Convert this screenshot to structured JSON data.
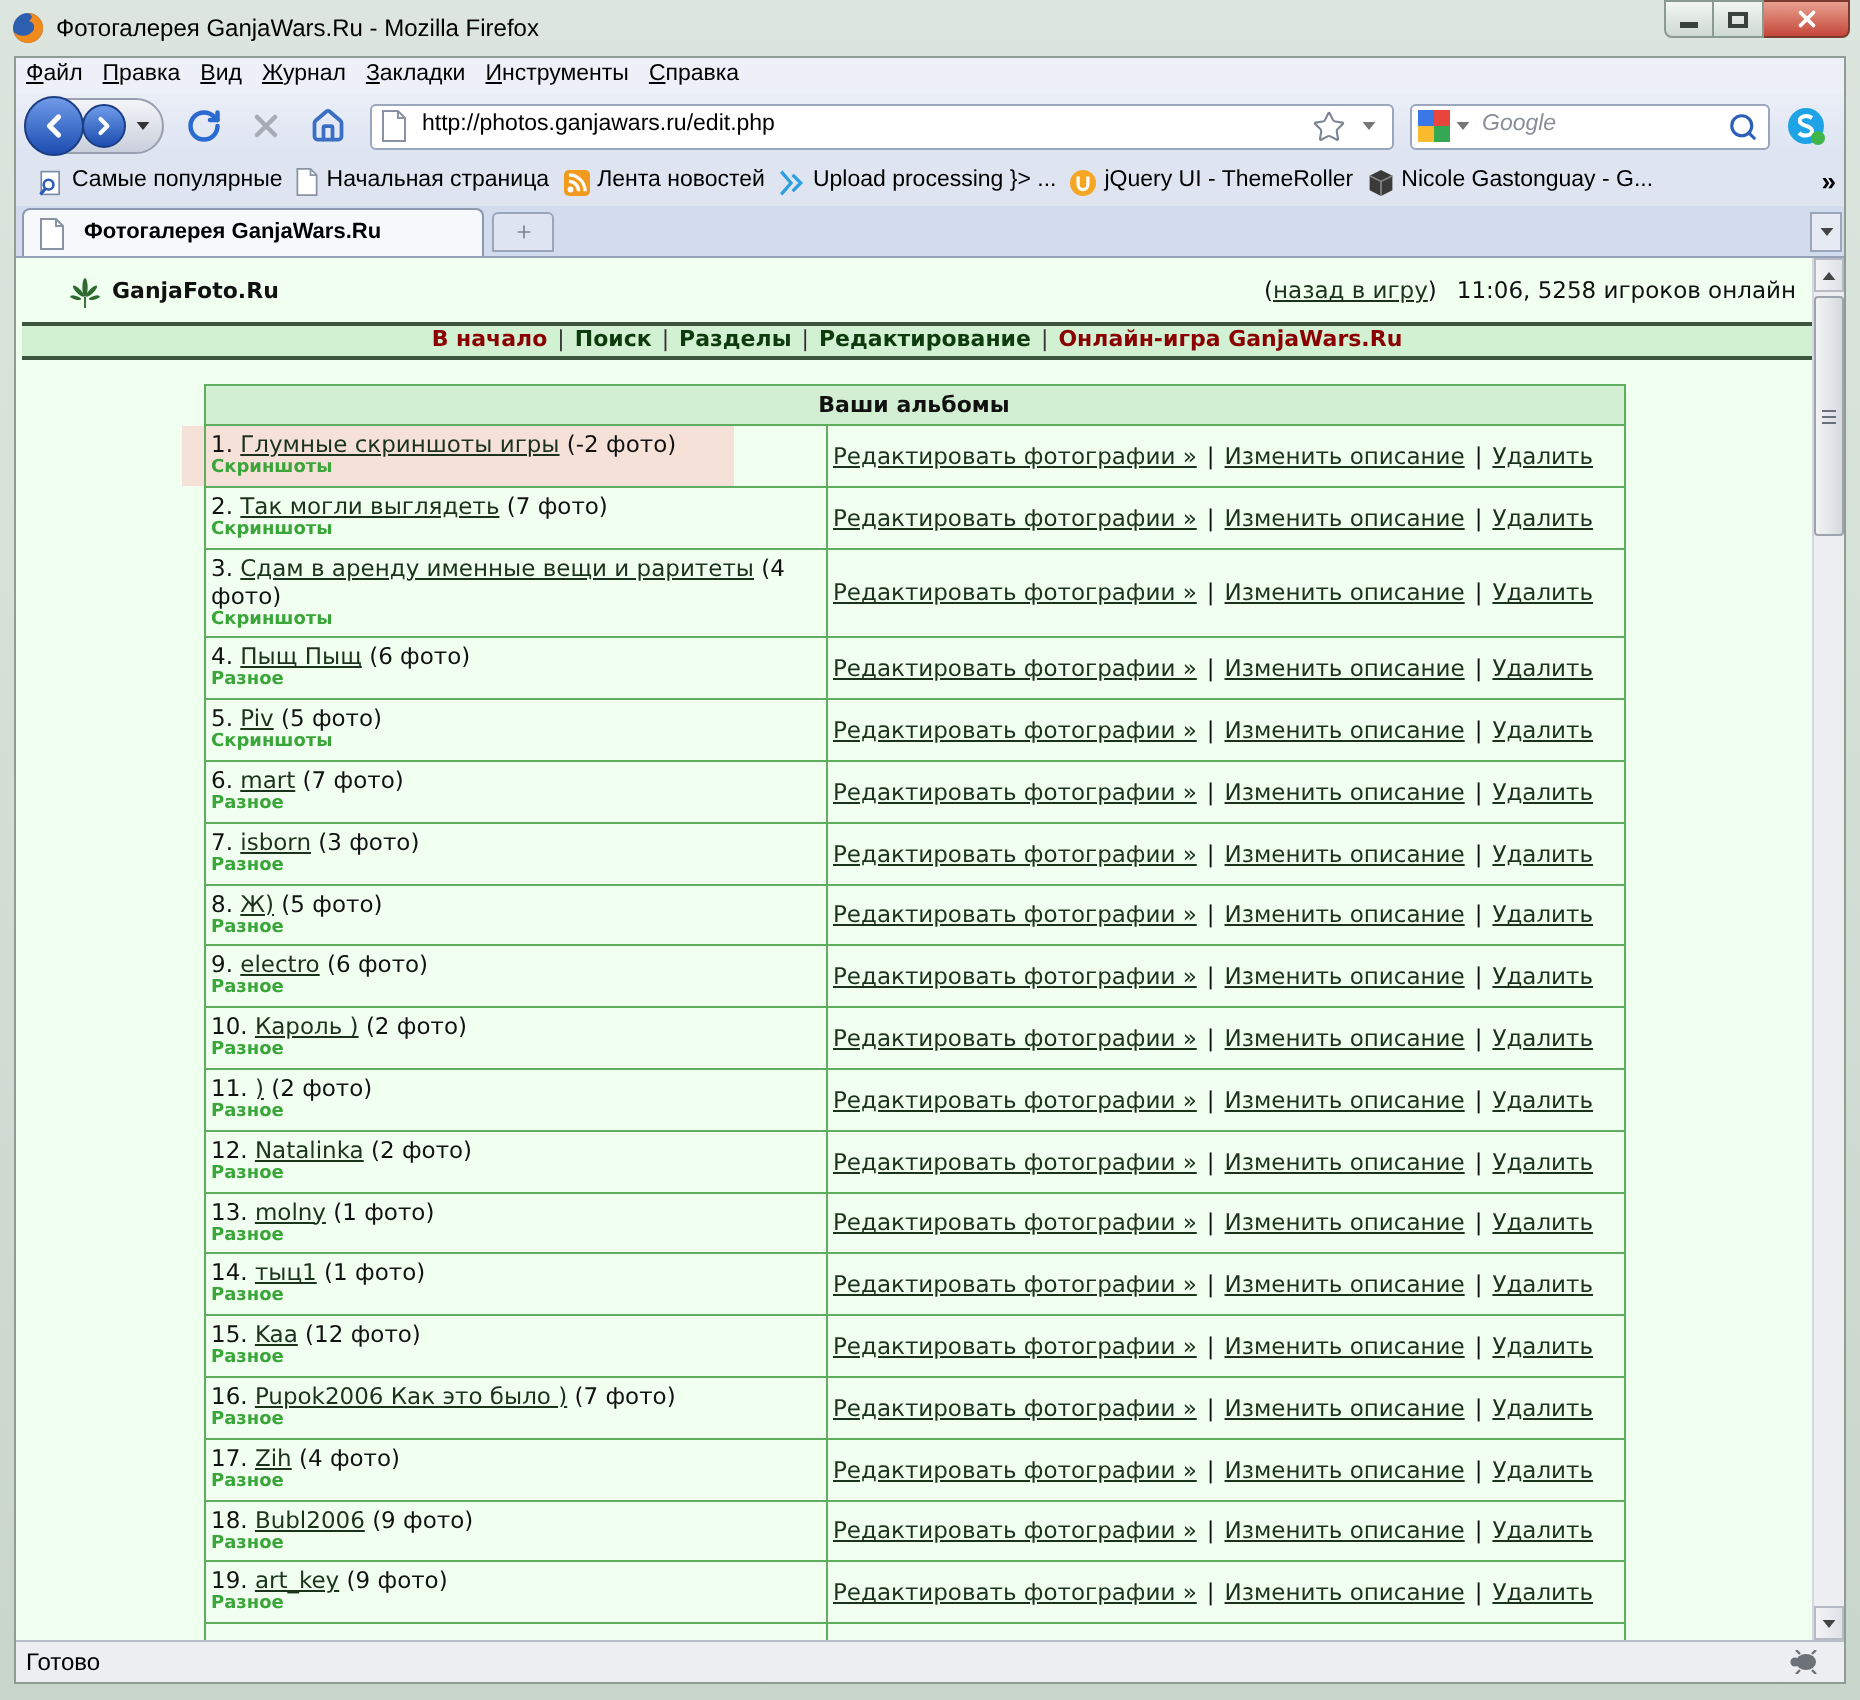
{
  "window": {
    "title": "Фотогалерея GanjaWars.Ru - Mozilla Firefox"
  },
  "menu": [
    "Файл",
    "Правка",
    "Вид",
    "Журнал",
    "Закладки",
    "Инструменты",
    "Справка"
  ],
  "address_bar": {
    "url": "http://photos.ganjawars.ru/edit.php"
  },
  "search": {
    "placeholder": "Google"
  },
  "bookmarks": {
    "items": [
      {
        "label": "Самые популярные",
        "kind": "smart"
      },
      {
        "label": "Начальная страница",
        "kind": "page"
      },
      {
        "label": "Лента новостей",
        "kind": "feed"
      },
      {
        "label": "Upload processing }> ...",
        "kind": "code"
      },
      {
        "label": "jQuery UI - ThemeRoller",
        "kind": "round"
      },
      {
        "label": "Nicole Gastonguay - G...",
        "kind": "cube"
      }
    ],
    "overflow": "»"
  },
  "tabs": [
    {
      "label": "Фотогалерея GanjaWars.Ru",
      "selected": true
    }
  ],
  "site": {
    "logo": "GanjaFoto.Ru",
    "back_link": {
      "before": "(",
      "label": "назад в игру",
      "after": ")"
    },
    "online_status": "11:06, 5258 игроков онлайн"
  },
  "nav": [
    {
      "kind": "link",
      "label": "В начало",
      "color": "#8b0000"
    },
    {
      "kind": "separator",
      "label": "|"
    },
    {
      "kind": "link",
      "label": "Поиск",
      "color": "#0d3b0d"
    },
    {
      "kind": "separator",
      "label": "|"
    },
    {
      "kind": "link",
      "label": "Разделы",
      "color": "#0d3b0d"
    },
    {
      "kind": "separator",
      "label": "|"
    },
    {
      "kind": "link",
      "label": "Редактирование",
      "color": "#0d3b0d"
    },
    {
      "kind": "separator",
      "label": "|"
    },
    {
      "kind": "link",
      "label": "Онлайн-игра GanjaWars.Ru",
      "color": "#8b0000"
    }
  ],
  "table": {
    "title": "Ваши альбомы",
    "rows": [
      {
        "number": "1.",
        "title": "Глумные скриншоты игры",
        "count": "(-2 фото)",
        "category": "Скриншоты",
        "highlighted": true,
        "links": [
          "Редактировать фотографии »",
          "Изменить описание",
          "Удалить"
        ],
        "separators": [
          "|",
          "|"
        ]
      },
      {
        "number": "2.",
        "title": "Так могли выглядеть",
        "count": "(7 фото)",
        "category": "Скриншоты",
        "highlighted": false,
        "links": [
          "Редактировать фотографии »",
          "Изменить описание",
          "Удалить"
        ],
        "separators": [
          "|",
          "|"
        ]
      },
      {
        "number": "3.",
        "title": "Сдам в аренду именные вещи и раритеты",
        "count": "(4 фото)",
        "category": "Скриншоты",
        "highlighted": false,
        "links": [
          "Редактировать фотографии »",
          "Изменить описание",
          "Удалить"
        ],
        "separators": [
          "|",
          "|"
        ]
      },
      {
        "number": "4.",
        "title": "Пыщ Пыщ",
        "count": "(6 фото)",
        "category": "Разное",
        "highlighted": false,
        "links": [
          "Редактировать фотографии »",
          "Изменить описание",
          "Удалить"
        ],
        "separators": [
          "|",
          "|"
        ]
      },
      {
        "number": "5.",
        "title": "Piv",
        "count": "(5 фото)",
        "category": "Скриншоты",
        "highlighted": false,
        "links": [
          "Редактировать фотографии »",
          "Изменить описание",
          "Удалить"
        ],
        "separators": [
          "|",
          "|"
        ]
      },
      {
        "number": "6.",
        "title": "mart",
        "count": "(7 фото)",
        "category": "Разное",
        "highlighted": false,
        "links": [
          "Редактировать фотографии »",
          "Изменить описание",
          "Удалить"
        ],
        "separators": [
          "|",
          "|"
        ]
      },
      {
        "number": "7.",
        "title": "isborn",
        "count": "(3 фото)",
        "category": "Разное",
        "highlighted": false,
        "links": [
          "Редактировать фотографии »",
          "Изменить описание",
          "Удалить"
        ],
        "separators": [
          "|",
          "|"
        ]
      },
      {
        "number": "8.",
        "title": "Ж)",
        "count": "(5 фото)",
        "category": "Разное",
        "highlighted": false,
        "links": [
          "Редактировать фотографии »",
          "Изменить описание",
          "Удалить"
        ],
        "separators": [
          "|",
          "|"
        ]
      },
      {
        "number": "9.",
        "title": "electro",
        "count": "(6 фото)",
        "category": "Разное",
        "highlighted": false,
        "links": [
          "Редактировать фотографии »",
          "Изменить описание",
          "Удалить"
        ],
        "separators": [
          "|",
          "|"
        ]
      },
      {
        "number": "10.",
        "title": "Кароль )",
        "count": "(2 фото)",
        "category": "Разное",
        "highlighted": false,
        "links": [
          "Редактировать фотографии »",
          "Изменить описание",
          "Удалить"
        ],
        "separators": [
          "|",
          "|"
        ]
      },
      {
        "number": "11.",
        "title": ")",
        "count": "(2 фото)",
        "category": "Разное",
        "highlighted": false,
        "links": [
          "Редактировать фотографии »",
          "Изменить описание",
          "Удалить"
        ],
        "separators": [
          "|",
          "|"
        ]
      },
      {
        "number": "12.",
        "title": "Natalinka",
        "count": "(2 фото)",
        "category": "Разное",
        "highlighted": false,
        "links": [
          "Редактировать фотографии »",
          "Изменить описание",
          "Удалить"
        ],
        "separators": [
          "|",
          "|"
        ]
      },
      {
        "number": "13.",
        "title": "molny",
        "count": "(1 фото)",
        "category": "Разное",
        "highlighted": false,
        "links": [
          "Редактировать фотографии »",
          "Изменить описание",
          "Удалить"
        ],
        "separators": [
          "|",
          "|"
        ]
      },
      {
        "number": "14.",
        "title": "тыц1",
        "count": "(1 фото)",
        "category": "Разное",
        "highlighted": false,
        "links": [
          "Редактировать фотографии »",
          "Изменить описание",
          "Удалить"
        ],
        "separators": [
          "|",
          "|"
        ]
      },
      {
        "number": "15.",
        "title": "Kaa",
        "count": "(12 фото)",
        "category": "Разное",
        "highlighted": false,
        "links": [
          "Редактировать фотографии »",
          "Изменить описание",
          "Удалить"
        ],
        "separators": [
          "|",
          "|"
        ]
      },
      {
        "number": "16.",
        "title": "Pupok2006 Как это было )",
        "count": "(7 фото)",
        "category": "Разное",
        "highlighted": false,
        "links": [
          "Редактировать фотографии »",
          "Изменить описание",
          "Удалить"
        ],
        "separators": [
          "|",
          "|"
        ]
      },
      {
        "number": "17.",
        "title": "Zih",
        "count": "(4 фото)",
        "category": "Разное",
        "highlighted": false,
        "links": [
          "Редактировать фотографии »",
          "Изменить описание",
          "Удалить"
        ],
        "separators": [
          "|",
          "|"
        ]
      },
      {
        "number": "18.",
        "title": "Bubl2006",
        "count": "(9 фото)",
        "category": "Разное",
        "highlighted": false,
        "links": [
          "Редактировать фотографии »",
          "Изменить описание",
          "Удалить"
        ],
        "separators": [
          "|",
          "|"
        ]
      },
      {
        "number": "19.",
        "title": "art_key",
        "count": "(9 фото)",
        "category": "Разное",
        "highlighted": false,
        "links": [
          "Редактировать фотографии »",
          "Изменить описание",
          "Удалить"
        ],
        "separators": [
          "|",
          "|"
        ]
      },
      {
        "highlighted": false
      }
    ]
  },
  "status_bar": {
    "text": "Готово"
  }
}
